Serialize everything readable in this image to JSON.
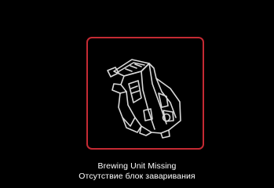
{
  "alert": {
    "icon": "brewing-unit-icon",
    "frame_color": "#c42a33",
    "message_en": "Brewing Unit Missing",
    "message_ru": "Отсутствие блок заваривания"
  }
}
